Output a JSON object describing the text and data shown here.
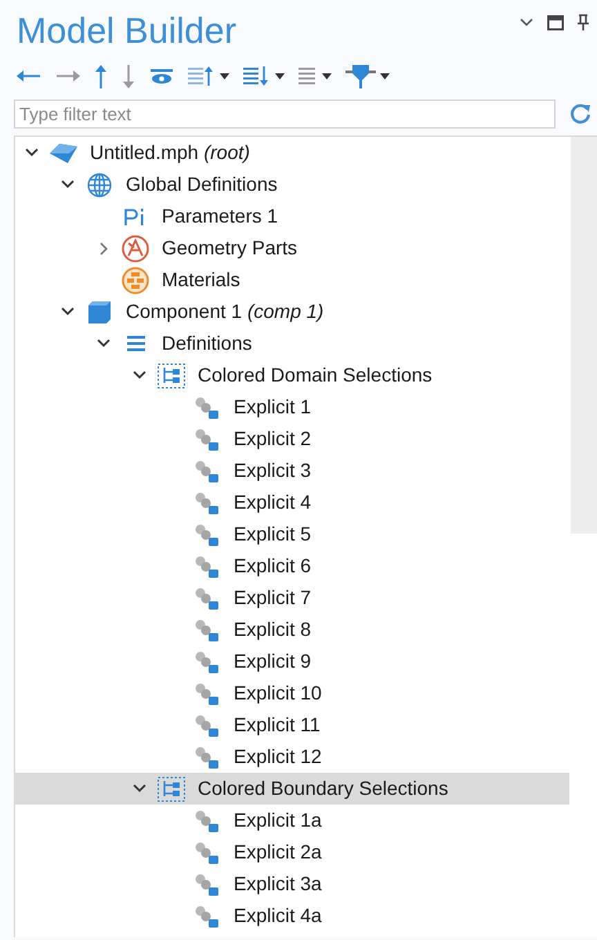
{
  "title": "Model Builder",
  "window_controls": [
    {
      "kind": "collapse"
    },
    {
      "kind": "maximize"
    },
    {
      "kind": "pin"
    }
  ],
  "toolbar": [
    {
      "kind": "back",
      "disabled": false
    },
    {
      "kind": "forward",
      "disabled": true
    },
    {
      "kind": "up",
      "disabled": false
    },
    {
      "kind": "down",
      "disabled": true
    },
    {
      "kind": "eye",
      "disabled": false
    },
    {
      "kind": "list-up",
      "disabled": false
    },
    {
      "kind": "list-down",
      "disabled": false
    },
    {
      "kind": "list",
      "disabled": true
    },
    {
      "kind": "filter",
      "disabled": false
    }
  ],
  "filter": {
    "placeholder": "Type filter text"
  },
  "tree": [
    {
      "label": "Untitled.mph *(root)*",
      "kind": "model",
      "expanded": true,
      "selected": false,
      "children": [
        {
          "label": "Global Definitions",
          "kind": "globe",
          "expanded": true,
          "selected": false,
          "children": [
            {
              "label": "Parameters 1",
              "kind": "parameters",
              "selected": false
            },
            {
              "label": "Geometry Parts",
              "kind": "geometry",
              "expanded": false,
              "selected": false
            },
            {
              "label": "Materials",
              "kind": "materials",
              "selected": false
            }
          ]
        },
        {
          "label": "Component 1 *(comp 1)*",
          "kind": "component",
          "expanded": true,
          "selected": false,
          "children": [
            {
              "label": "Definitions",
              "kind": "definitions",
              "expanded": true,
              "selected": false,
              "children": [
                {
                  "label": "Colored Domain Selections",
                  "kind": "group",
                  "expanded": true,
                  "selected": false,
                  "children": [
                    {
                      "label": "Explicit 1",
                      "kind": "explicit",
                      "selected": false
                    },
                    {
                      "label": "Explicit 2",
                      "kind": "explicit",
                      "selected": false
                    },
                    {
                      "label": "Explicit 3",
                      "kind": "explicit",
                      "selected": false
                    },
                    {
                      "label": "Explicit 4",
                      "kind": "explicit",
                      "selected": false
                    },
                    {
                      "label": "Explicit 5",
                      "kind": "explicit",
                      "selected": false
                    },
                    {
                      "label": "Explicit 6",
                      "kind": "explicit",
                      "selected": false
                    },
                    {
                      "label": "Explicit 7",
                      "kind": "explicit",
                      "selected": false
                    },
                    {
                      "label": "Explicit 8",
                      "kind": "explicit",
                      "selected": false
                    },
                    {
                      "label": "Explicit 9",
                      "kind": "explicit",
                      "selected": false
                    },
                    {
                      "label": "Explicit 10",
                      "kind": "explicit",
                      "selected": false
                    },
                    {
                      "label": "Explicit 11",
                      "kind": "explicit",
                      "selected": false
                    },
                    {
                      "label": "Explicit 12",
                      "kind": "explicit",
                      "selected": false
                    }
                  ]
                },
                {
                  "label": "Colored Boundary Selections",
                  "kind": "group",
                  "expanded": true,
                  "selected": true,
                  "children": [
                    {
                      "label": "Explicit 1a",
                      "kind": "explicit",
                      "selected": false
                    },
                    {
                      "label": "Explicit 2a",
                      "kind": "explicit",
                      "selected": false
                    },
                    {
                      "label": "Explicit 3a",
                      "kind": "explicit",
                      "selected": false
                    },
                    {
                      "label": "Explicit 4a",
                      "kind": "explicit",
                      "selected": false
                    }
                  ]
                }
              ]
            }
          ]
        }
      ]
    }
  ]
}
